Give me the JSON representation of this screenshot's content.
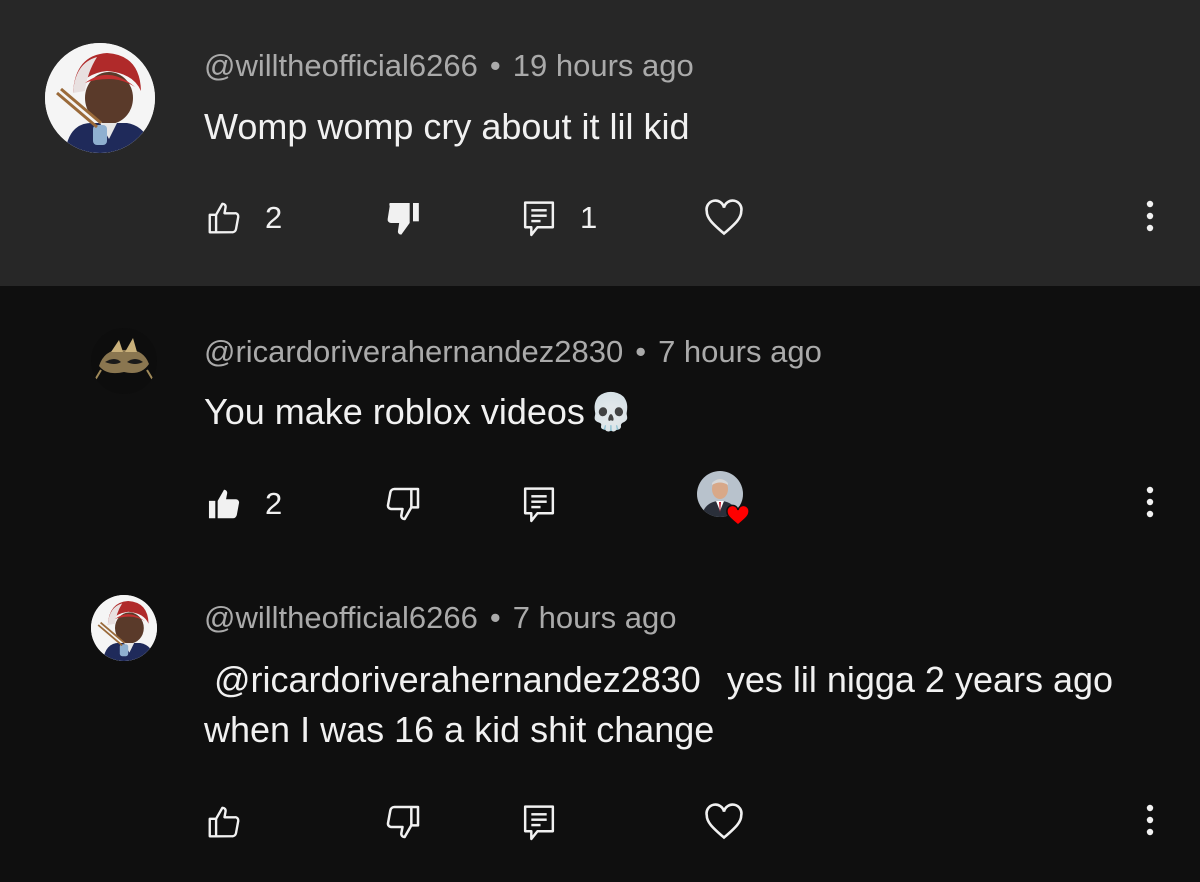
{
  "comments": [
    {
      "author": "@willtheofficial6266",
      "separator": "•",
      "time": "19 hours ago",
      "text": "Womp womp cry about it lil kid",
      "like_count": "2",
      "reply_count": "1",
      "liked": false,
      "disliked": true,
      "highlighted": true,
      "avatar_icon": "anime-character-avatar",
      "reaction": "heart-icon"
    },
    {
      "author": "@ricardoriverahernandez2830",
      "separator": "•",
      "time": "7 hours ago",
      "text": "You make roblox videos",
      "text_emoji": "💀",
      "like_count": "2",
      "reply_count": "",
      "liked": true,
      "disliked": false,
      "highlighted": false,
      "avatar_icon": "mask-avatar",
      "reaction": "creator-heart-badge"
    },
    {
      "author": "@willtheofficial6266",
      "separator": "•",
      "time": "7 hours ago",
      "mention": "@ricardoriverahernandez2830",
      "text": "yes lil nigga 2 years ago when I was 16 a kid shit change",
      "like_count": "",
      "reply_count": "",
      "liked": false,
      "disliked": false,
      "highlighted": false,
      "avatar_icon": "anime-character-avatar",
      "reaction": "heart-icon"
    }
  ],
  "colors": {
    "highlight_bg": "#272727",
    "page_bg": "#0f0f0f",
    "text_primary": "#f1f1f1",
    "text_secondary": "#aaaaaa",
    "heart_red": "#ff0000"
  }
}
